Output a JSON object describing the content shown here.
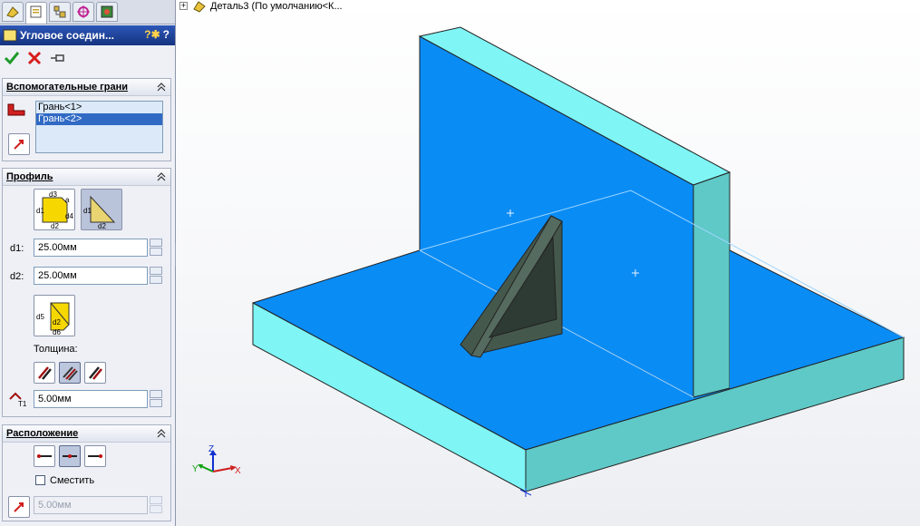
{
  "panel": {
    "title": "Угловое соедин...",
    "help": "?",
    "groups": {
      "faces": {
        "title": "Вспомогательные грани",
        "items": [
          "Грань<1>",
          "Грань<2>"
        ],
        "selected_index": 1
      },
      "profile": {
        "title": "Профиль",
        "d1_label": "d1:",
        "d1_value": "25.00мм",
        "d2_label": "d2:",
        "d2_value": "25.00мм",
        "thickness_label": "Толщина:",
        "t1_value": "5.00мм",
        "profile_icon_labels": [
          "d1",
          "d2",
          "d3",
          "d4",
          "a"
        ],
        "triangle_icon_labels": [
          "d1",
          "d2"
        ],
        "chamfer_icon_labels": [
          "d5",
          "d2",
          "d6"
        ],
        "t1_icon_label": "T1"
      },
      "location": {
        "title": "Расположение",
        "offset_label": "Сместить",
        "offset_value": "5.00мм"
      }
    }
  },
  "tree": {
    "label": "Деталь3  (По умолчанию<К..."
  },
  "axes": {
    "x": "X",
    "y": "Y",
    "z": "Z"
  },
  "colors": {
    "face_top": "#0a8cf5",
    "face_side": "#5fc9c7",
    "face_edge": "#7ff5f5",
    "gusset": "#556b5f",
    "title_bar": "#1a3a8a"
  }
}
